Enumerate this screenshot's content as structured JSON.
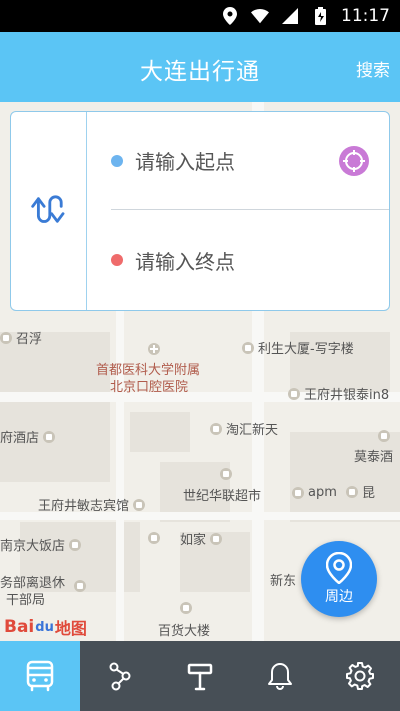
{
  "status": {
    "time": "11:17"
  },
  "header": {
    "title": "大连出行通",
    "search_label": "搜索"
  },
  "route": {
    "start_placeholder": "请输入起点",
    "end_placeholder": "请输入终点"
  },
  "map": {
    "labels": {
      "hospital": "首都医科大学附属",
      "hospital2": "北京口腔医院",
      "office": "利生大厦-写字楼",
      "jinbao": "王府井银泰in8",
      "hotel": "府酒店",
      "taohui": "淘汇新天",
      "motai": "莫泰酒",
      "minzhi": "王府井敏志宾馆",
      "shijihua": "世纪华联超市",
      "apm": "apm",
      "kun": "昆",
      "nanjing": "南京大饭店",
      "rujia": "如家",
      "xindong": "新东",
      "wubu": "务部离退休",
      "ganbu": "干部局",
      "baihuo": "百货大楼",
      "left_edge": "召浮"
    },
    "baidu_logo": {
      "bai": "Bai",
      "du": "du",
      "tail": "地图"
    }
  },
  "nearby_label": "周边",
  "tabs": [
    "bus",
    "route-plan",
    "station",
    "notification",
    "settings"
  ],
  "colors": {
    "primary": "#5bc5f5",
    "tabbar": "#474f56",
    "nearby": "#2e8ef0",
    "start_dot": "#6db4ef",
    "end_dot": "#ef6b6b"
  }
}
